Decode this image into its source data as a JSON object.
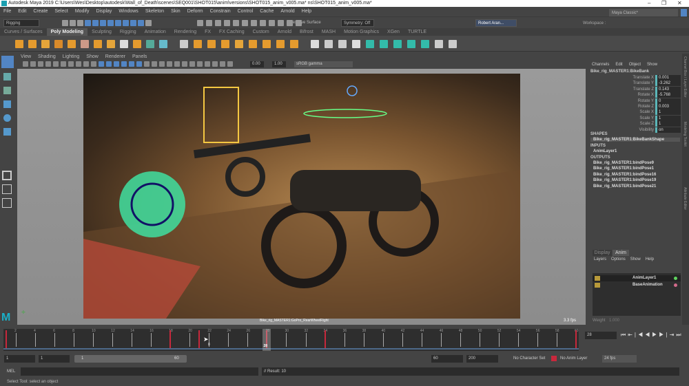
{
  "title": "Autodesk Maya 2019  C:\\Users\\Wes\\Desktop\\autodesk\\Wall_of_Death\\scenes\\SEQ001\\SHOT015\\anim\\versions\\SHOT015_anim_v005.ma*  ns\\SHOT015_anim_v005.ma*",
  "window_controls": {
    "minimize": "–",
    "maximize": "❐",
    "close": "✕"
  },
  "menus": [
    "File",
    "Edit",
    "Create",
    "Select",
    "Modify",
    "Display",
    "Windows",
    "Skeleton",
    "Skin",
    "Deform",
    "Constrain",
    "Control",
    "Cache",
    "Arnold",
    "Help"
  ],
  "status": {
    "mode": "Rigging",
    "live_surface": "No Live Surface",
    "symmetry": "Symmetry: Off",
    "user": "Robert Aran...",
    "workspace_label": "Workspace :",
    "workspace": "Maya Classic*"
  },
  "shelf_tabs": [
    "Curves / Surfaces",
    "Poly Modeling",
    "Sculpting",
    "Rigging",
    "Animation",
    "Rendering",
    "FX",
    "FX Caching",
    "Custom",
    "Arnold",
    "Bifrost",
    "MASH",
    "Motion Graphics",
    "XGen",
    "TURTLE"
  ],
  "active_shelf": "Poly Modeling",
  "viewport": {
    "menus": [
      "View",
      "Shading",
      "Lighting",
      "Show",
      "Renderer",
      "Panels"
    ],
    "exposure": "0.00",
    "gamma": "1.00",
    "color_space": "sRGB gamma",
    "camera_label": "Bike_rig_MASTER1:GoPro_RearWheelRight",
    "fps": "3.3 fps"
  },
  "channel_box": {
    "menus": [
      "Channels",
      "Edit",
      "Object",
      "Show"
    ],
    "object": "Bike_rig_MASTER1:BikeBank",
    "attrs": [
      {
        "name": "Translate X",
        "value": "0.001"
      },
      {
        "name": "Translate Y",
        "value": "-3.262"
      },
      {
        "name": "Translate Z",
        "value": "0.143"
      },
      {
        "name": "Rotate X",
        "value": "-5.768"
      },
      {
        "name": "Rotate Y",
        "value": "0"
      },
      {
        "name": "Rotate Z",
        "value": "0.003"
      },
      {
        "name": "Scale X",
        "value": "1"
      },
      {
        "name": "Scale Y",
        "value": "1"
      },
      {
        "name": "Scale Z",
        "value": "1"
      },
      {
        "name": "Visibility",
        "value": "on"
      }
    ],
    "shapes_label": "SHAPES",
    "shapes": [
      "Bike_rig_MASTER1:BikeBankShape"
    ],
    "inputs_label": "INPUTS",
    "inputs": [
      "AnimLayer1"
    ],
    "outputs_label": "OUTPUTS",
    "outputs": [
      "Bike_rig_MASTER1:bindPose9",
      "Bike_rig_MASTER1:bindPose1",
      "Bike_rig_MASTER1:bindPose16",
      "Bike_rig_MASTER1:bindPose19",
      "Bike_rig_MASTER1:bindPose21"
    ]
  },
  "side_tabs": [
    "Channel Box / Layer Editor",
    "Modeling Toolkit",
    "Attribute Editor"
  ],
  "layer_editor": {
    "tabs": [
      "Display",
      "Anim"
    ],
    "menus": [
      "Layers",
      "Options",
      "Show",
      "Help"
    ],
    "layers": [
      {
        "name": "AnimLayer1",
        "color": "#5fd35f"
      },
      {
        "name": "BaseAnimation",
        "color": "#d36a8a"
      }
    ],
    "weight_label": "Weight",
    "weight": "1.000"
  },
  "timeline": {
    "start": 1,
    "end": 60,
    "current": 28,
    "current_label": "28",
    "keys": [
      1,
      18,
      21,
      28,
      34,
      60
    ],
    "cursor_frame_label": "8"
  },
  "playback": {
    "current_frame": "28"
  },
  "range": {
    "start": "1",
    "playback_start": "1",
    "slider_start": "1",
    "slider_end": "60",
    "playback_end": "60",
    "end": "200",
    "character_set": "No Character Set",
    "anim_layer": "No Anim Layer",
    "fps": "24 fps"
  },
  "mel": {
    "label": "MEL",
    "result": "// Result: 10"
  },
  "help_line": "Select Tool: select an object",
  "colors": {
    "accent": "#5285c4",
    "key": "#c8283c",
    "teal": "#5bb6b8"
  }
}
